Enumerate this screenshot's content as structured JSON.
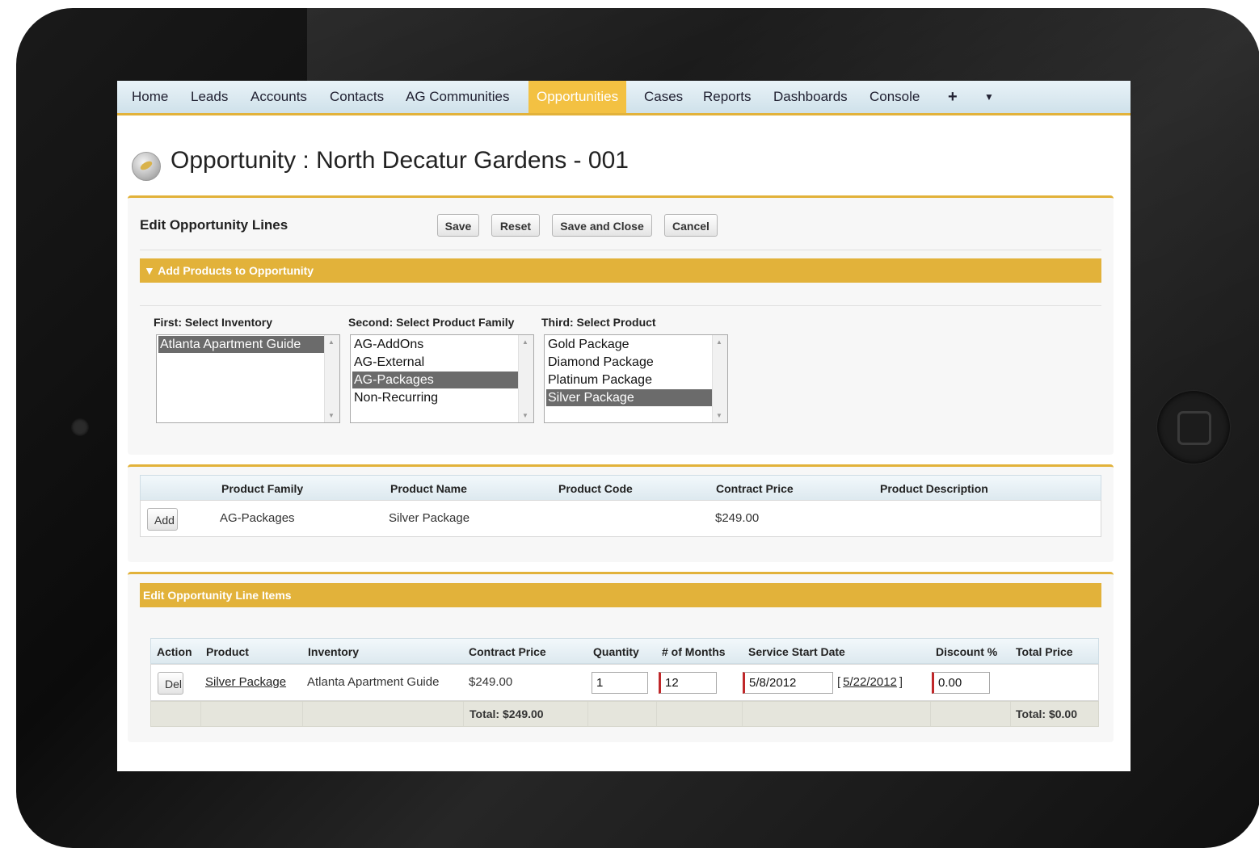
{
  "nav": {
    "items": [
      "Home",
      "Leads",
      "Accounts",
      "Contacts",
      "AG Communities",
      "Opportunities",
      "Cases",
      "Reports",
      "Dashboards",
      "Console"
    ],
    "active": "Opportunities",
    "plus_icon": "+",
    "dropdown_icon": "▼"
  },
  "page": {
    "title": "Opportunity : North Decatur Gardens - 001"
  },
  "edit_lines": {
    "title": "Edit Opportunity Lines",
    "buttons": {
      "save": "Save",
      "reset": "Reset",
      "save_close": "Save and Close",
      "cancel": "Cancel"
    }
  },
  "add_products": {
    "bar_label": "▼ Add Products to Opportunity",
    "inventory": {
      "label": "First: Select Inventory",
      "options": [
        "Atlanta Apartment Guide"
      ],
      "selected": "Atlanta Apartment Guide"
    },
    "family": {
      "label": "Second: Select Product Family",
      "options": [
        "AG-AddOns",
        "AG-External",
        "AG-Packages",
        "Non-Recurring"
      ],
      "selected": "AG-Packages"
    },
    "product": {
      "label": "Third: Select Product",
      "options": [
        "Gold Package",
        "Diamond Package",
        "Platinum Package",
        "Silver Package"
      ],
      "selected": "Silver Package"
    }
  },
  "products_table": {
    "headers": [
      "Product Family",
      "Product Name",
      "Product Code",
      "Contract Price",
      "Product Description"
    ],
    "row": {
      "action": "Add",
      "family": "AG-Packages",
      "name": "Silver Package",
      "code": "",
      "price": "$249.00",
      "description": ""
    }
  },
  "line_items": {
    "bar_label": "Edit Opportunity Line Items",
    "headers": [
      "Action",
      "Product",
      "Inventory",
      "Contract Price",
      "Quantity",
      "# of Months",
      "Service Start Date",
      "Discount %",
      "Total Price"
    ],
    "row": {
      "action": "Del",
      "product": "Silver Package",
      "inventory": "Atlanta Apartment Guide",
      "price": "$249.00",
      "quantity": "1",
      "months": "12",
      "start_date": "5/8/2012",
      "date_link_prefix": "[",
      "date_link": "5/22/2012",
      "date_link_suffix": "]",
      "discount": "0.00",
      "total": ""
    },
    "totals": {
      "contract": "Total: $249.00",
      "price": "Total: $0.00"
    }
  }
}
